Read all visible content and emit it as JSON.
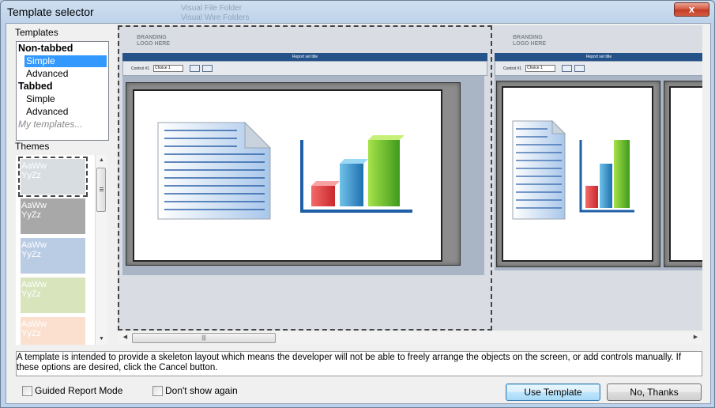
{
  "window": {
    "title": "Template selector",
    "ghost_lines": [
      "Visual File Folder",
      "Visual Wire Folders"
    ],
    "close_glyph": "x"
  },
  "templates": {
    "label": "Templates",
    "items": [
      {
        "text": "Non-tabbed",
        "kind": "group"
      },
      {
        "text": "Simple",
        "kind": "sub",
        "selected": true
      },
      {
        "text": "Advanced",
        "kind": "sub"
      },
      {
        "text": "Tabbed",
        "kind": "group"
      },
      {
        "text": "Simple",
        "kind": "sub"
      },
      {
        "text": "Advanced",
        "kind": "sub"
      },
      {
        "text": "My templates...",
        "kind": "my"
      }
    ]
  },
  "themes": {
    "label": "Themes",
    "swatches": [
      {
        "line1": "AaWw",
        "line2": "YyZz",
        "color": "#d8dde2",
        "selected": true
      },
      {
        "line1": "AaWw",
        "line2": "YyZz",
        "color": "#a8a8a8"
      },
      {
        "line1": "AaWw",
        "line2": "YyZz",
        "color": "#b9cce4"
      },
      {
        "line1": "AaWw",
        "line2": "YyZz",
        "color": "#d7e4bc"
      },
      {
        "line1": "AaWw",
        "line2": "YyZz",
        "color": "#fbe0d0"
      }
    ]
  },
  "preview": {
    "brand_line1": "BRANDING",
    "brand_line2": "LOGO HERE",
    "report_title": "Report set title",
    "control_label": "Control #1",
    "choice_value": "Choice 1",
    "accent": "#26528a"
  },
  "hscroll_grip": "|||",
  "info_text": "A template is intended to provide a skeleton layout which means the developer will not be able to freely arrange the objects on the screen, or add controls manually. If these options are desired, click the Cancel button.",
  "options": {
    "guided_label": "Guided Report Mode",
    "dont_show_label": "Don't show again"
  },
  "buttons": {
    "use_template": "Use Template",
    "no_thanks": "No, Thanks"
  }
}
